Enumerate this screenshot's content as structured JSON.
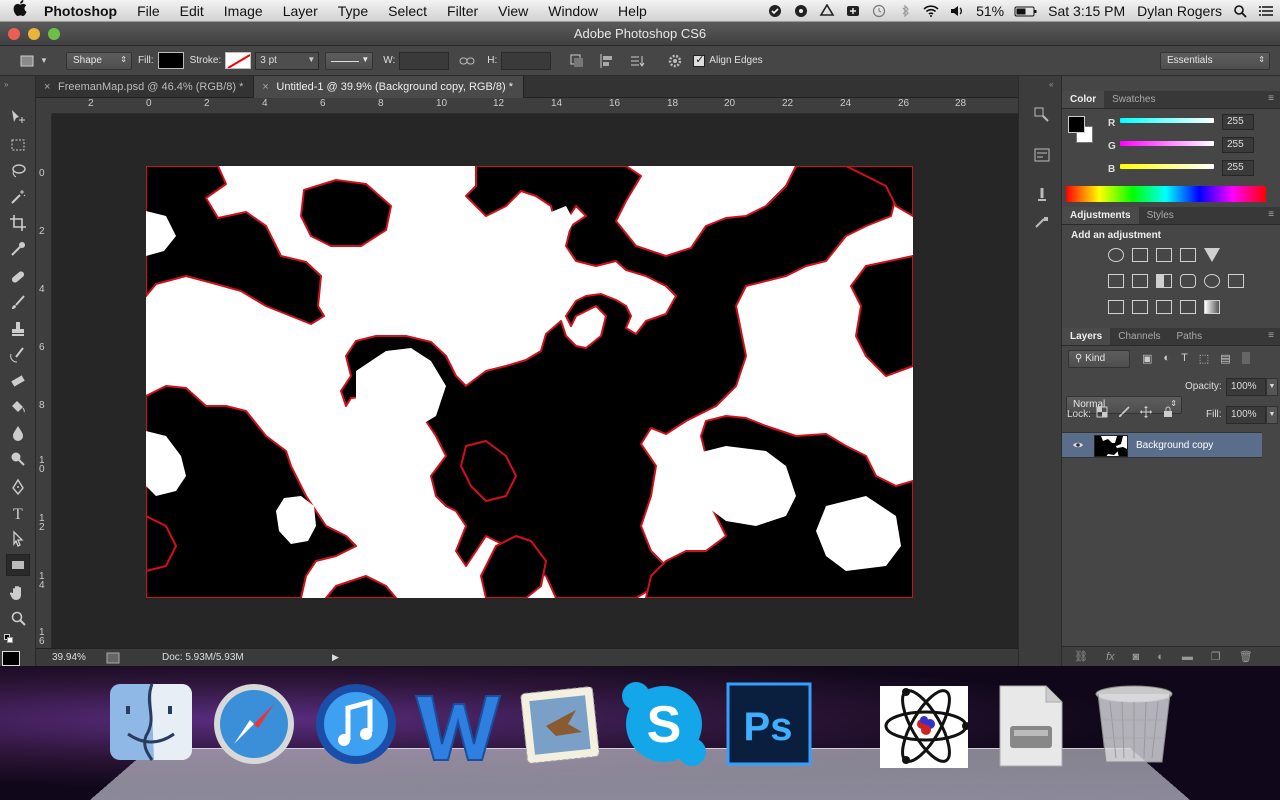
{
  "menubar": {
    "app": "Photoshop",
    "menus": [
      "File",
      "Edit",
      "Image",
      "Layer",
      "Type",
      "Select",
      "Filter",
      "View",
      "Window",
      "Help"
    ],
    "battery": "51%",
    "clock": "Sat 3:15 PM",
    "user": "Dylan Rogers"
  },
  "window": {
    "title": "Adobe Photoshop CS6"
  },
  "options": {
    "mode": "Shape",
    "fill_label": "Fill:",
    "stroke_label": "Stroke:",
    "stroke_size": "3 pt",
    "w_label": "W:",
    "h_label": "H:",
    "align_edges": "Align Edges",
    "workspace": "Essentials"
  },
  "tabs": [
    {
      "label": "FreemanMap.psd @ 46.4% (RGB/8) *"
    },
    {
      "label": "Untitled-1 @ 39.9% (Background copy, RGB/8) *"
    }
  ],
  "ruler": {
    "h": [
      "2",
      "0",
      "2",
      "4",
      "6",
      "8",
      "10",
      "12",
      "14",
      "16",
      "18",
      "20",
      "22",
      "24",
      "26",
      "28"
    ],
    "v": [
      "0",
      "2",
      "4",
      "6",
      "8",
      "1\n0",
      "1\n2",
      "1\n4",
      "1\n6"
    ]
  },
  "status": {
    "zoom": "39.94%",
    "doc": "Doc: 5.93M/5.93M"
  },
  "color_panel": {
    "tabs": [
      "Color",
      "Swatches"
    ],
    "channels": [
      {
        "name": "R",
        "value": "255",
        "color": "#00ffff"
      },
      {
        "name": "G",
        "value": "255",
        "color": "#ff00ff"
      },
      {
        "name": "B",
        "value": "255",
        "color": "#ffff00"
      }
    ]
  },
  "adjust_panel": {
    "tabs": [
      "Adjustments",
      "Styles"
    ],
    "heading": "Add an adjustment"
  },
  "layers_panel": {
    "tabs": [
      "Layers",
      "Channels",
      "Paths"
    ],
    "kind": "Kind",
    "blend_mode": "Normal",
    "opacity_label": "Opacity:",
    "opacity": "100%",
    "lock_label": "Lock:",
    "fill_label": "Fill:",
    "fill": "100%",
    "layers": [
      {
        "name": "Background copy"
      }
    ]
  },
  "dock": {
    "apps": [
      "finder-icon",
      "safari-icon",
      "itunes-icon",
      "word-icon",
      "mail-icon",
      "skype-icon",
      "photoshop-icon",
      "atom-app-icon",
      "disk-utility-icon",
      "trash-icon"
    ]
  }
}
